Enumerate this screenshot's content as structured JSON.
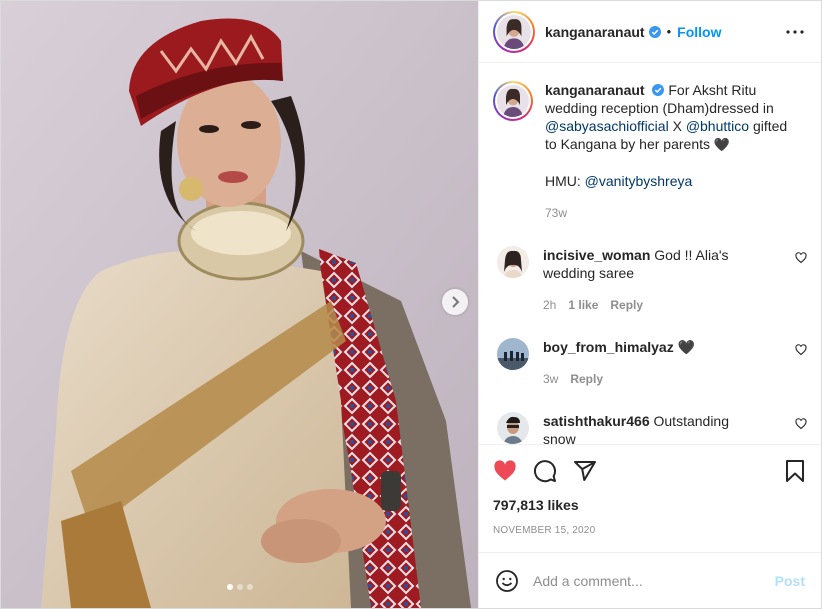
{
  "post": {
    "username": "kanganaranaut",
    "follow_label": "Follow",
    "separator": "•",
    "caption": {
      "username": "kanganaranaut",
      "text_1": "For Aksht Ritu wedding reception (Dham)dressed in",
      "mention_1": "@sabyasachiofficial",
      "joiner": "X",
      "mention_2": "@bhuttico",
      "text_2": "gifted to Kangana by her parents",
      "heart": "🖤",
      "hmu_label": "HMU:",
      "mention_3": "@vanitybyshreya",
      "time": "73w"
    },
    "comments": [
      {
        "username": "incisive_woman",
        "text": "God !! Alia's wedding saree",
        "time": "2h",
        "likes": "1 like",
        "reply": "Reply"
      },
      {
        "username": "boy_from_himalyaz",
        "text": "🖤",
        "time": "3w",
        "reply": "Reply"
      },
      {
        "username": "satishthakur466",
        "text": "Outstanding snow"
      }
    ],
    "likes": "797,813 likes",
    "date": "NOVEMBER 15, 2020",
    "add_comment_placeholder": "Add a comment...",
    "post_label": "Post",
    "carousel": {
      "count": 3,
      "active": 0
    }
  },
  "colors": {
    "accent": "#0095f6",
    "like_red": "#ed4956",
    "post_disabled": "#b2dffc",
    "muted": "#8e8e8e"
  },
  "icons": [
    "verified-badge-icon",
    "more-options-icon",
    "heart-icon",
    "comment-icon",
    "share-icon",
    "bookmark-icon",
    "emoji-icon",
    "chevron-right-icon"
  ]
}
